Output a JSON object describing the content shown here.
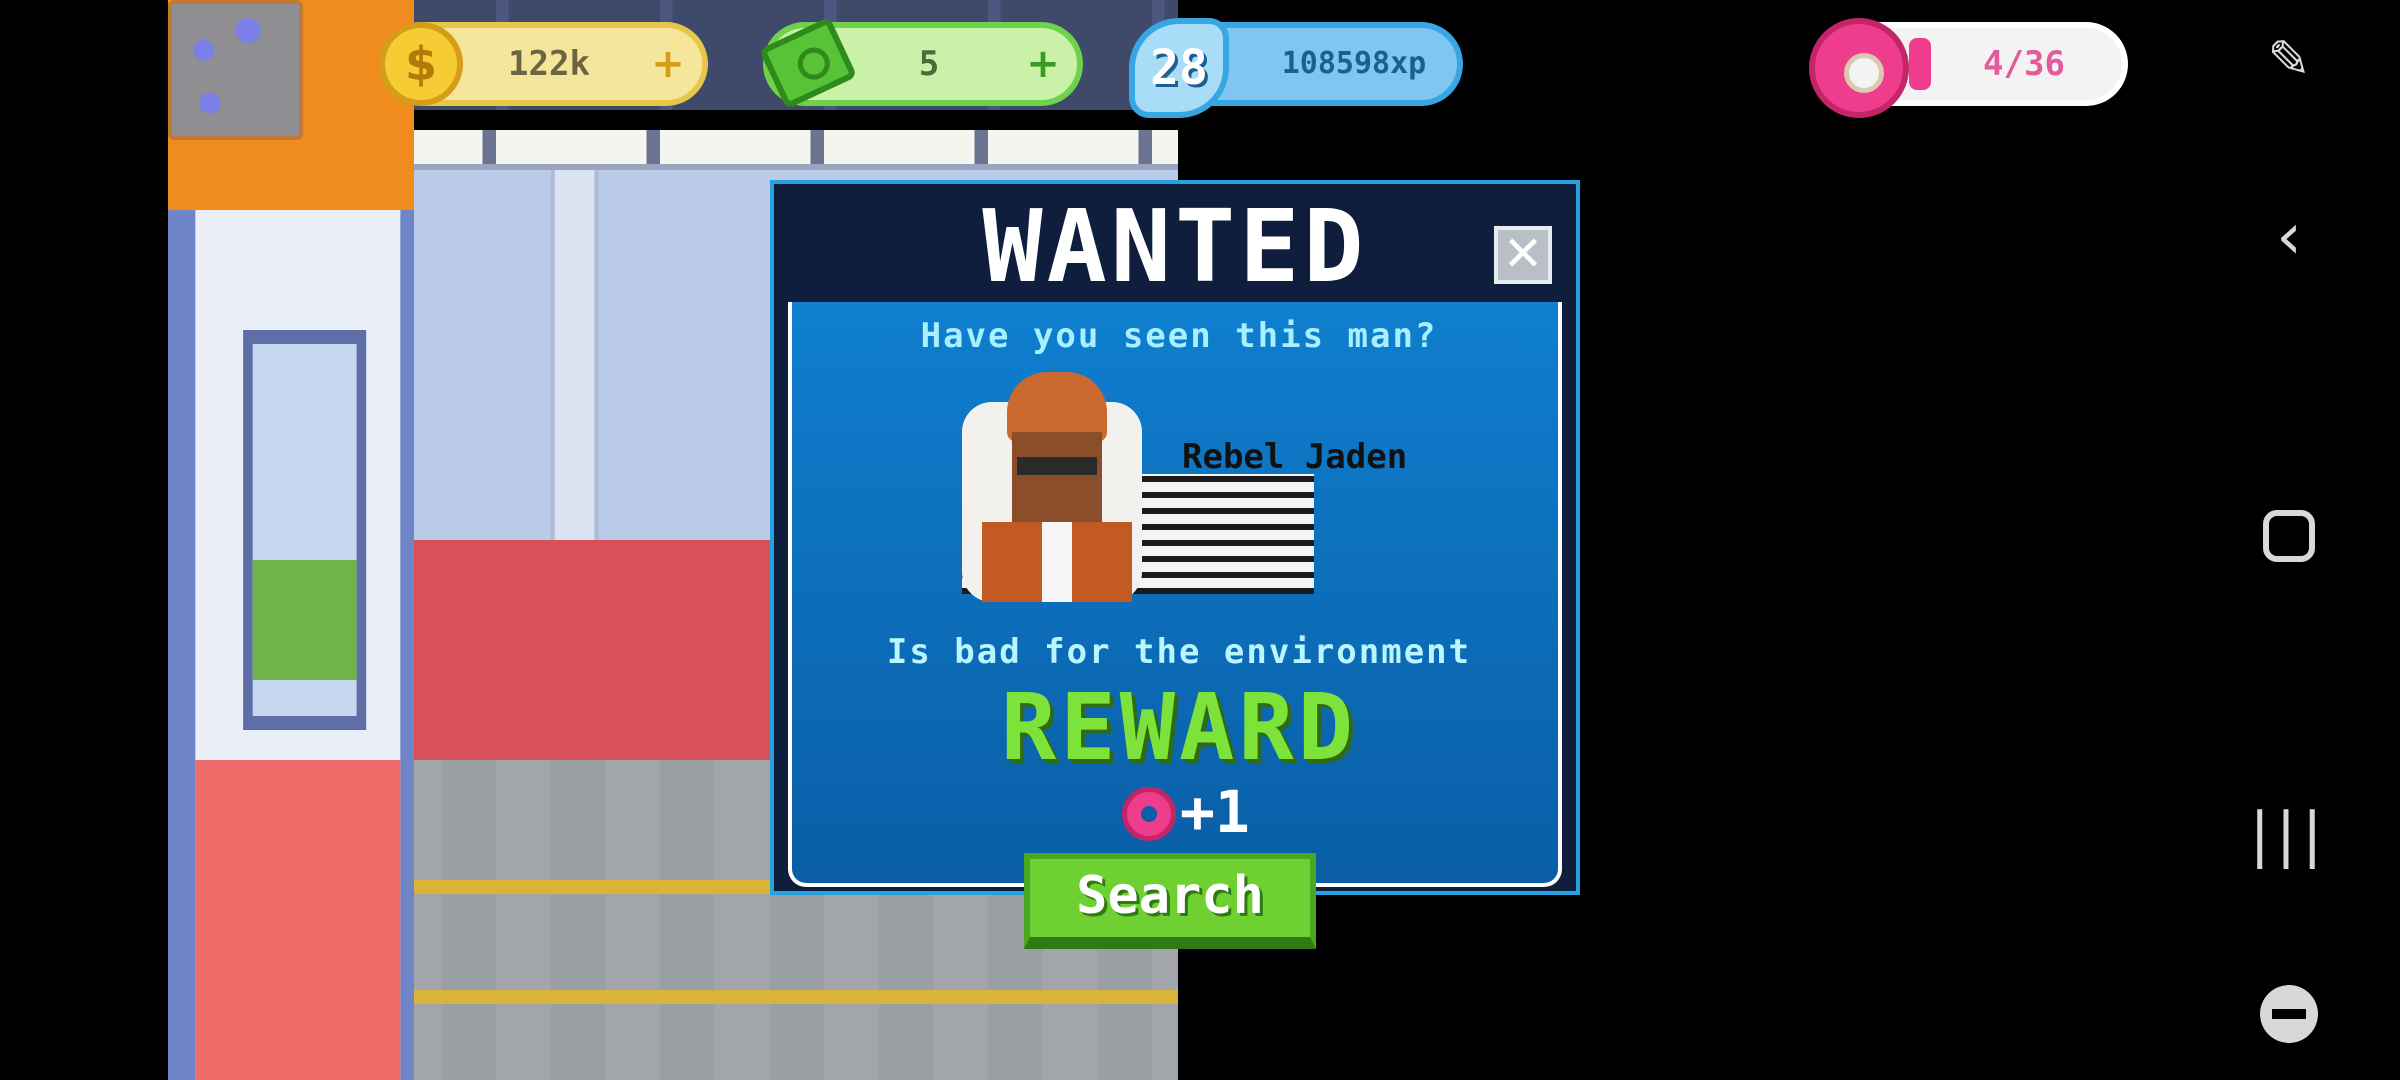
{
  "hud": {
    "coins": "122k",
    "cash": "5",
    "level": "28",
    "xp": "108598xp",
    "donuts": "4/36",
    "donut_progress": 0.11
  },
  "modal": {
    "title": "WANTED",
    "close_glyph": "✕",
    "subtitle": "Have you seen this man?",
    "name": "Rebel Jaden",
    "tagline": "Is bad for the environment",
    "reward_label": "REWARD",
    "reward_amount": "+1",
    "reward_icon": "donut-icon",
    "search_label": "Search"
  },
  "icons": {
    "coin": "$",
    "plus": "+",
    "back": "‹",
    "recent": "|||",
    "edit": "✎"
  },
  "colors": {
    "reward_green": "#7de23a",
    "modal_blue": "#0f7fcf",
    "search_green": "#6fd031",
    "donut_pink": "#ef3d8d"
  }
}
